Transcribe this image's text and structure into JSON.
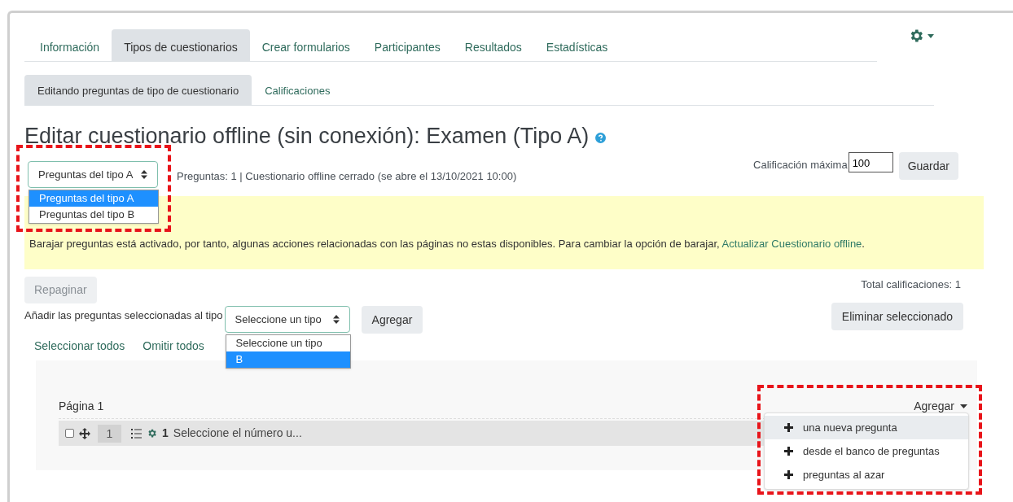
{
  "tabs": [
    {
      "label": "Información",
      "selected": false
    },
    {
      "label": "Tipos de cuestionarios",
      "selected": true
    },
    {
      "label": "Crear formularios",
      "selected": false
    },
    {
      "label": "Participantes",
      "selected": false
    },
    {
      "label": "Resultados",
      "selected": false
    },
    {
      "label": "Estadísticas",
      "selected": false
    }
  ],
  "subtabs": [
    {
      "label": "Editando preguntas de tipo de cuestionario",
      "selected": true
    },
    {
      "label": "Calificaciones",
      "selected": false
    }
  ],
  "title": "Editar cuestionario offline (sin conexión): Examen (Tipo A)",
  "type_select": {
    "value": "Preguntas del tipo A",
    "options": [
      {
        "label": "Preguntas del tipo A",
        "highlighted": true
      },
      {
        "label": "Preguntas del tipo B",
        "highlighted": false
      }
    ]
  },
  "summary": "Preguntas: 1 | Cuestionario offline cerrado (se abre el 13/10/2021 10:00)",
  "max_grade": {
    "label": "Calificación máxima",
    "value": "100",
    "button": "Guardar"
  },
  "notice": {
    "text": "Barajar preguntas está activado, por tanto, algunas acciones relacionadas con las páginas no estas disponibles. Para cambiar la opción de barajar, ",
    "link": "Actualizar Cuestionario offline",
    "end": "."
  },
  "total": "Total calificaciones: 1",
  "repaginate": {
    "label": "Repaginar",
    "disabled": true
  },
  "add_to_type": {
    "label": "Añadir las preguntas seleccionadas al tipo",
    "select": {
      "value": "Seleccione un tipo",
      "options": [
        {
          "label": "Seleccione un tipo",
          "highlighted": false
        },
        {
          "label": "B",
          "highlighted": true
        }
      ]
    },
    "button": "Agregar"
  },
  "delete_button": "Eliminar seleccionado",
  "select_links": [
    "Seleccionar todos",
    "Omitir todos"
  ],
  "page": {
    "heading": "Página 1",
    "questions": [
      {
        "checked": false,
        "page": "1",
        "number": "1",
        "text": "Seleccione el número u..."
      }
    ]
  },
  "add_menu": {
    "label": "Agregar",
    "items": [
      {
        "label": "una nueva pregunta",
        "selected": true
      },
      {
        "label": "desde el banco de preguntas",
        "selected": false
      },
      {
        "label": "preguntas al azar",
        "selected": false
      }
    ]
  }
}
